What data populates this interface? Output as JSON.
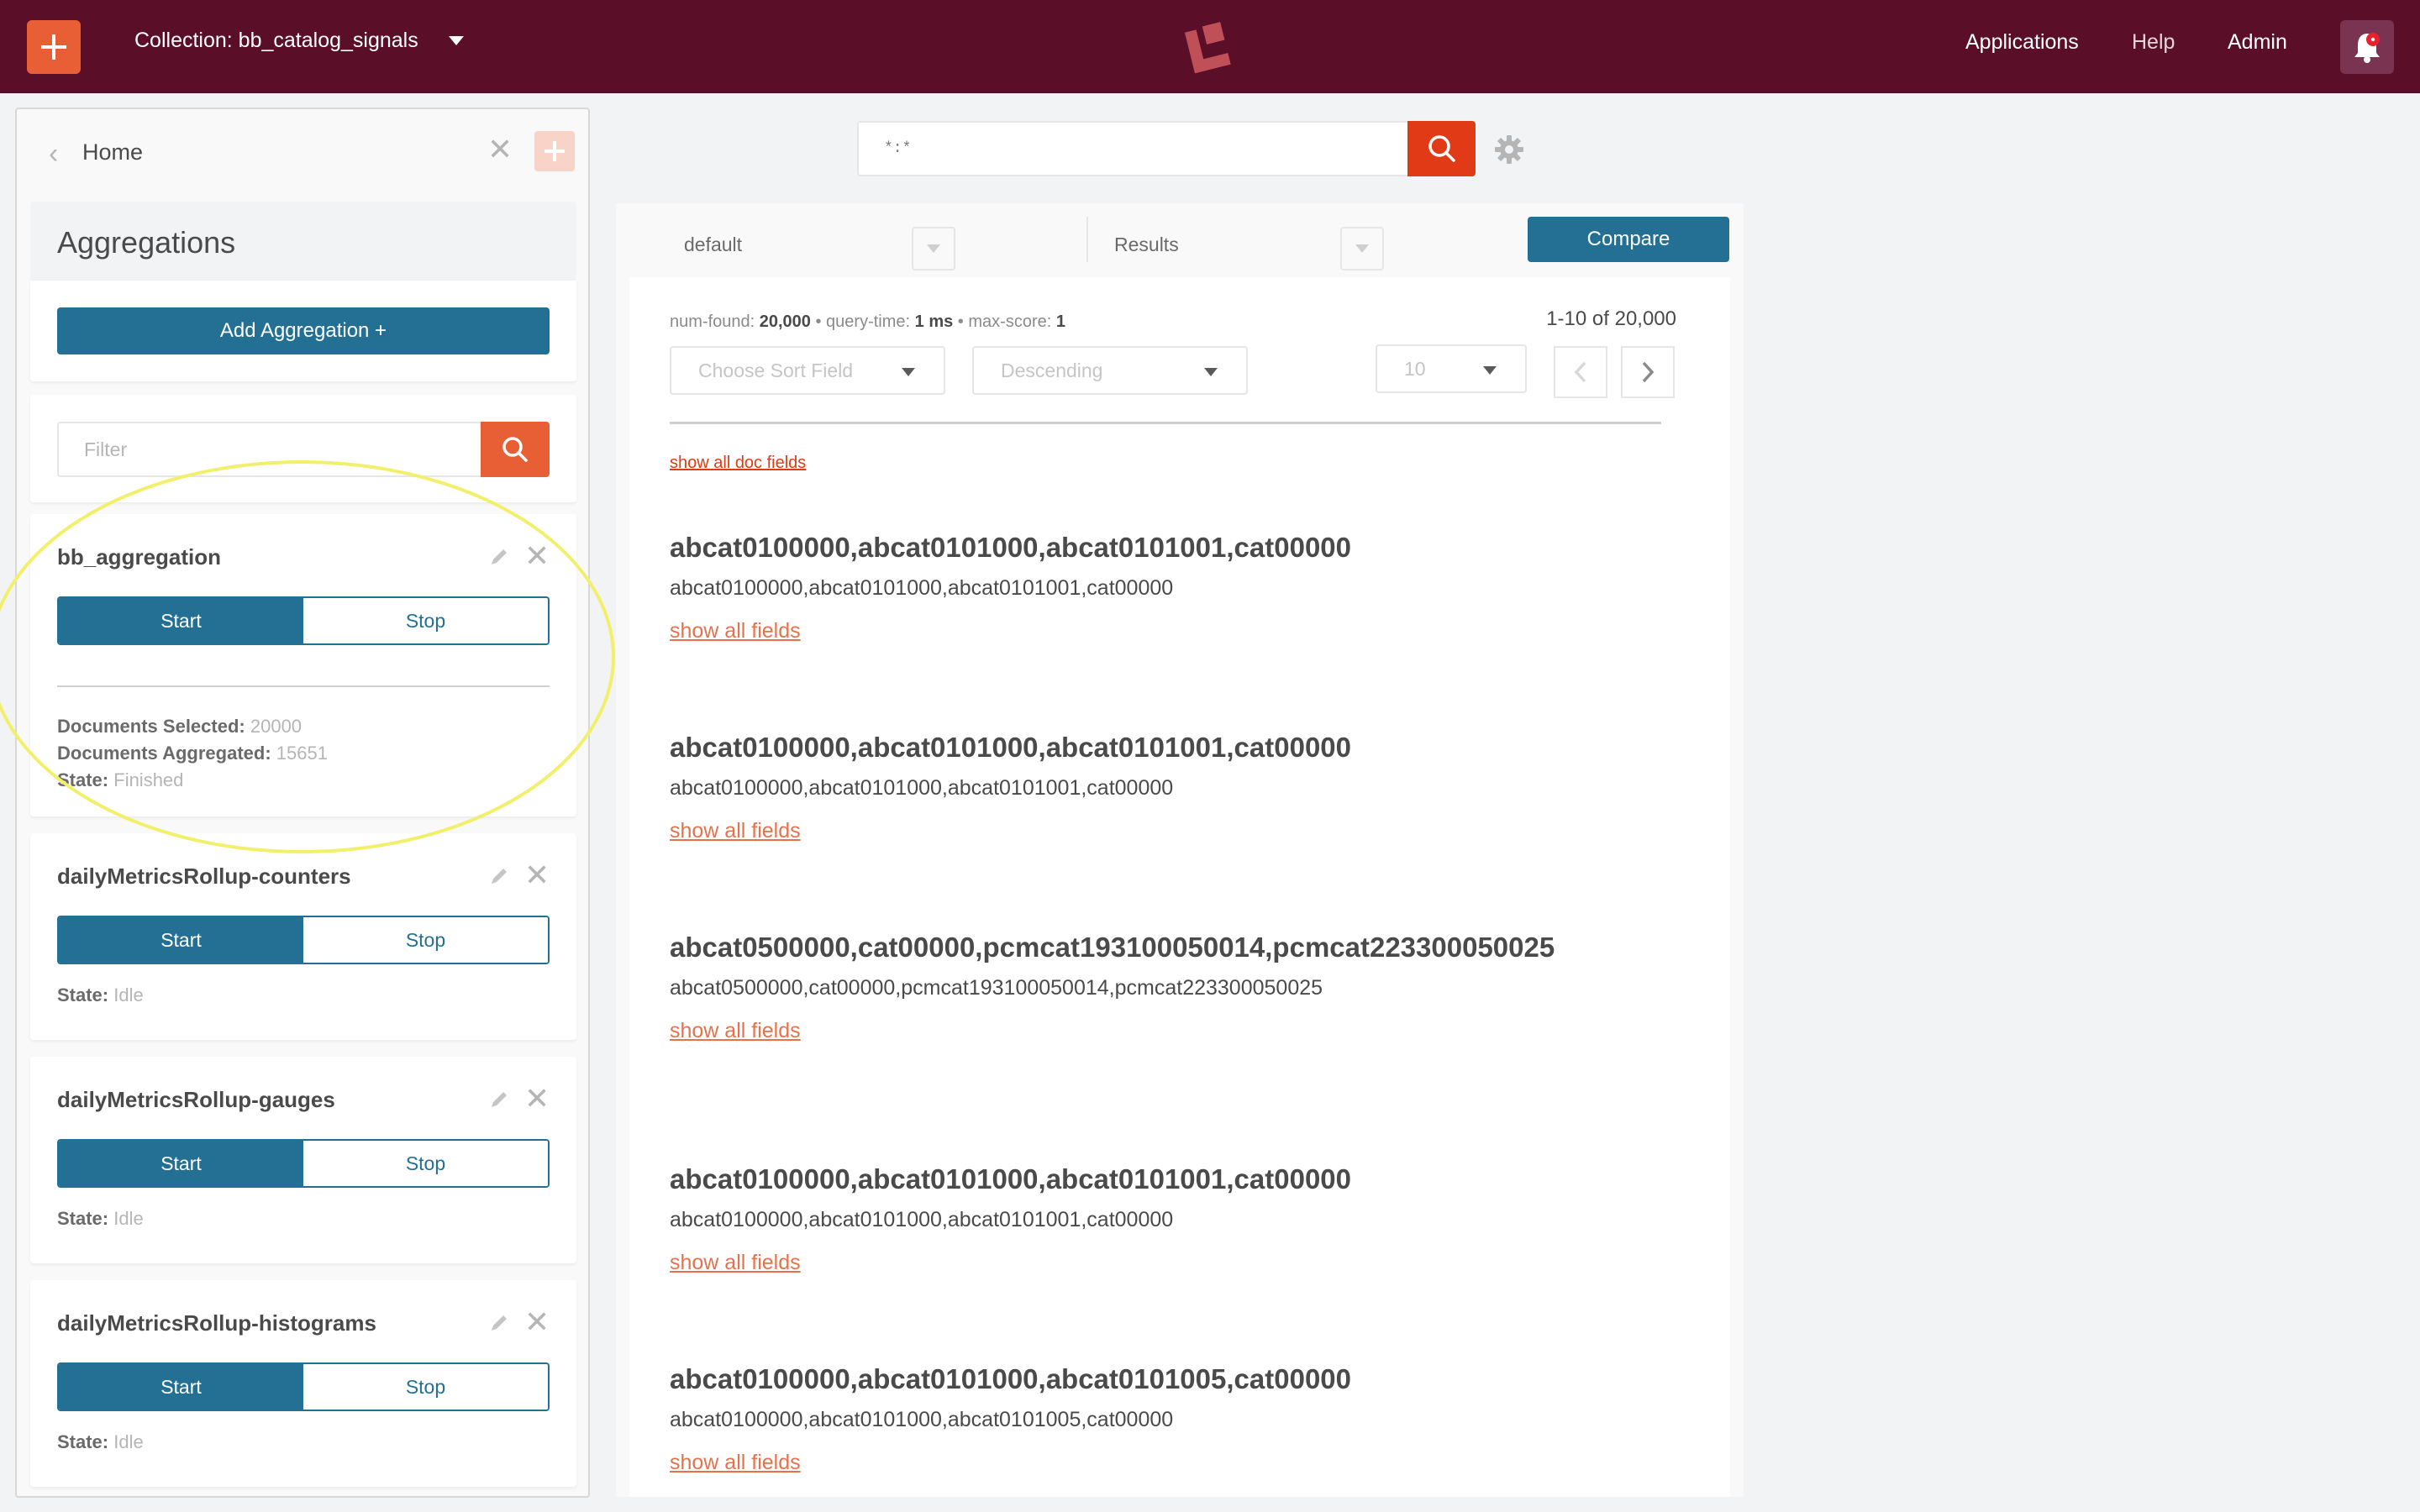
{
  "header": {
    "collection_label": "Collection: bb_catalog_signals",
    "nav": [
      "Applications",
      "Help",
      "Admin"
    ],
    "colors": {
      "bar": "#5a0e28",
      "accent": "#e85f35",
      "logo": "#c05058"
    }
  },
  "sidebar": {
    "back_label": "Home",
    "title": "Aggregations",
    "add_button": "Add Aggregation +",
    "filter_placeholder": "Filter",
    "aggregations": [
      {
        "name": "bb_aggregation",
        "start_label": "Start",
        "stop_label": "Stop",
        "stats": [
          {
            "label": "Documents Selected:",
            "value": "20000"
          },
          {
            "label": "Documents Aggregated:",
            "value": "15651"
          },
          {
            "label": "State:",
            "value": "Finished"
          }
        ]
      },
      {
        "name": "dailyMetricsRollup-counters",
        "start_label": "Start",
        "stop_label": "Stop",
        "stats": [
          {
            "label": "State:",
            "value": "Idle"
          }
        ]
      },
      {
        "name": "dailyMetricsRollup-gauges",
        "start_label": "Start",
        "stop_label": "Stop",
        "stats": [
          {
            "label": "State:",
            "value": "Idle"
          }
        ]
      },
      {
        "name": "dailyMetricsRollup-histograms",
        "start_label": "Start",
        "stop_label": "Stop",
        "stats": [
          {
            "label": "State:",
            "value": "Idle"
          }
        ]
      }
    ]
  },
  "search": {
    "query": "*:*"
  },
  "results": {
    "toolbar": {
      "pipeline": "default",
      "view": "Results",
      "compare_label": "Compare"
    },
    "meta": {
      "num_found_label": "num-found:",
      "num_found": "20,000",
      "query_time_label": "query-time:",
      "query_time": "1 ms",
      "max_score_label": "max-score:",
      "max_score": "1",
      "separator": "•"
    },
    "range": "1-10 of 20,000",
    "sort_field_placeholder": "Choose Sort Field",
    "sort_order": "Descending",
    "page_size": "10",
    "show_all_doc_fields": "show all doc fields",
    "items": [
      {
        "title": "abcat0100000,abcat0101000,abcat0101001,cat00000",
        "subtitle": "abcat0100000,abcat0101000,abcat0101001,cat00000",
        "link": "show all fields"
      },
      {
        "title": "abcat0100000,abcat0101000,abcat0101001,cat00000",
        "subtitle": "abcat0100000,abcat0101000,abcat0101001,cat00000",
        "link": "show all fields"
      },
      {
        "title": "abcat0500000,cat00000,pcmcat193100050014,pcmcat223300050025",
        "subtitle": "abcat0500000,cat00000,pcmcat193100050014,pcmcat223300050025",
        "link": "show all fields"
      },
      {
        "title": "abcat0100000,abcat0101000,abcat0101001,cat00000",
        "subtitle": "abcat0100000,abcat0101000,abcat0101001,cat00000",
        "link": "show all fields"
      },
      {
        "title": "abcat0100000,abcat0101000,abcat0101005,cat00000",
        "subtitle": "abcat0100000,abcat0101000,abcat0101005,cat00000",
        "link": "show all fields"
      }
    ]
  }
}
